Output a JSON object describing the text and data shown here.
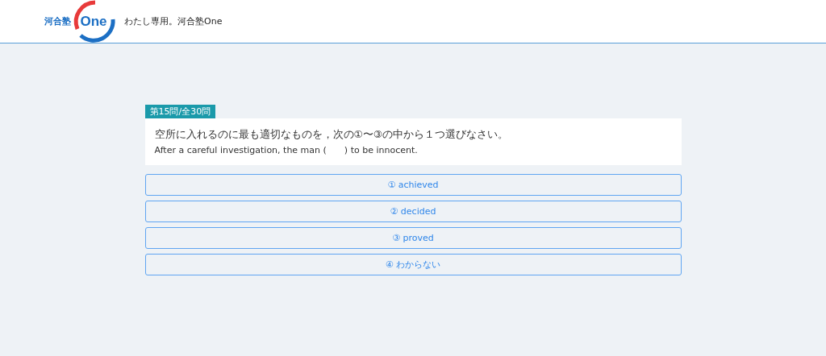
{
  "header": {
    "logo_mark": "河合塾",
    "logo_word": "One",
    "tagline": "わたし専用。河合塾One"
  },
  "question": {
    "counter": "第15問/全30問",
    "instruction": "空所に入れるのに最も適切なものを，次の①〜③の中から１つ選びなさい。",
    "sentence": "After a careful investigation, the man (　　) to be innocent."
  },
  "choices": [
    {
      "label": "① achieved"
    },
    {
      "label": "② decided"
    },
    {
      "label": "③ proved"
    },
    {
      "label": "④ わからない"
    }
  ]
}
